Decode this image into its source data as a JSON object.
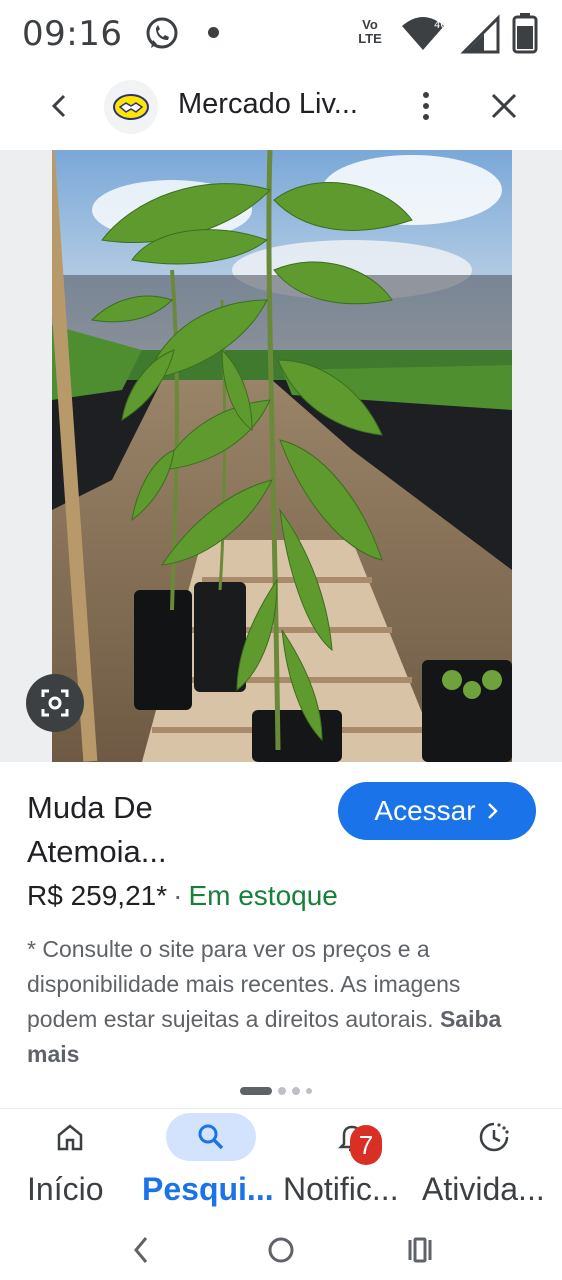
{
  "status_bar": {
    "time": "09:16",
    "volte_line1": "Vo",
    "volte_line2": "LTE",
    "network": "4G",
    "icons": [
      "whatsapp-icon",
      "notification-dot",
      "volte-icon",
      "wifi-icon",
      "signal-icon",
      "battery-icon"
    ]
  },
  "header": {
    "site_title": "Mercado Liv...",
    "icons": [
      "back-arrow-icon",
      "mercado-livre-logo",
      "more-vert-icon",
      "close-icon"
    ]
  },
  "product": {
    "title_line1": "Muda De",
    "title_line2": "Atemoia...",
    "visit_label": "Acessar",
    "visit_icon": "chevron-right-icon",
    "price": "R$ 259,21*",
    "separator": "·",
    "stock": "Em estoque",
    "disclaimer": "* Consulte o site para ver os preços e a disponibilidade mais recentes. As imagens podem estar sujeitas a direitos autorais.",
    "learn_more": "Saiba mais",
    "image_subject": "atemoia seedling in nursery greenhouse"
  },
  "pagination": {
    "current": 1,
    "total": 4
  },
  "bottom_nav": {
    "items": [
      {
        "label": "Início",
        "icon": "home-icon"
      },
      {
        "label": "Pesqui...",
        "icon": "search-icon",
        "active": true
      },
      {
        "label": "Notific...",
        "icon": "bell-icon",
        "badge": "7"
      },
      {
        "label": "Ativida...",
        "icon": "activity-icon"
      }
    ]
  },
  "system_nav": {
    "icons": [
      "system-back-icon",
      "system-home-icon",
      "system-recents-icon"
    ]
  },
  "colors": {
    "accent": "#1a73e8",
    "stock_green": "#188038",
    "badge_red": "#d93025",
    "active_pill": "#d3e3fd",
    "text": "#202124",
    "secondary_text": "#5f6368"
  }
}
